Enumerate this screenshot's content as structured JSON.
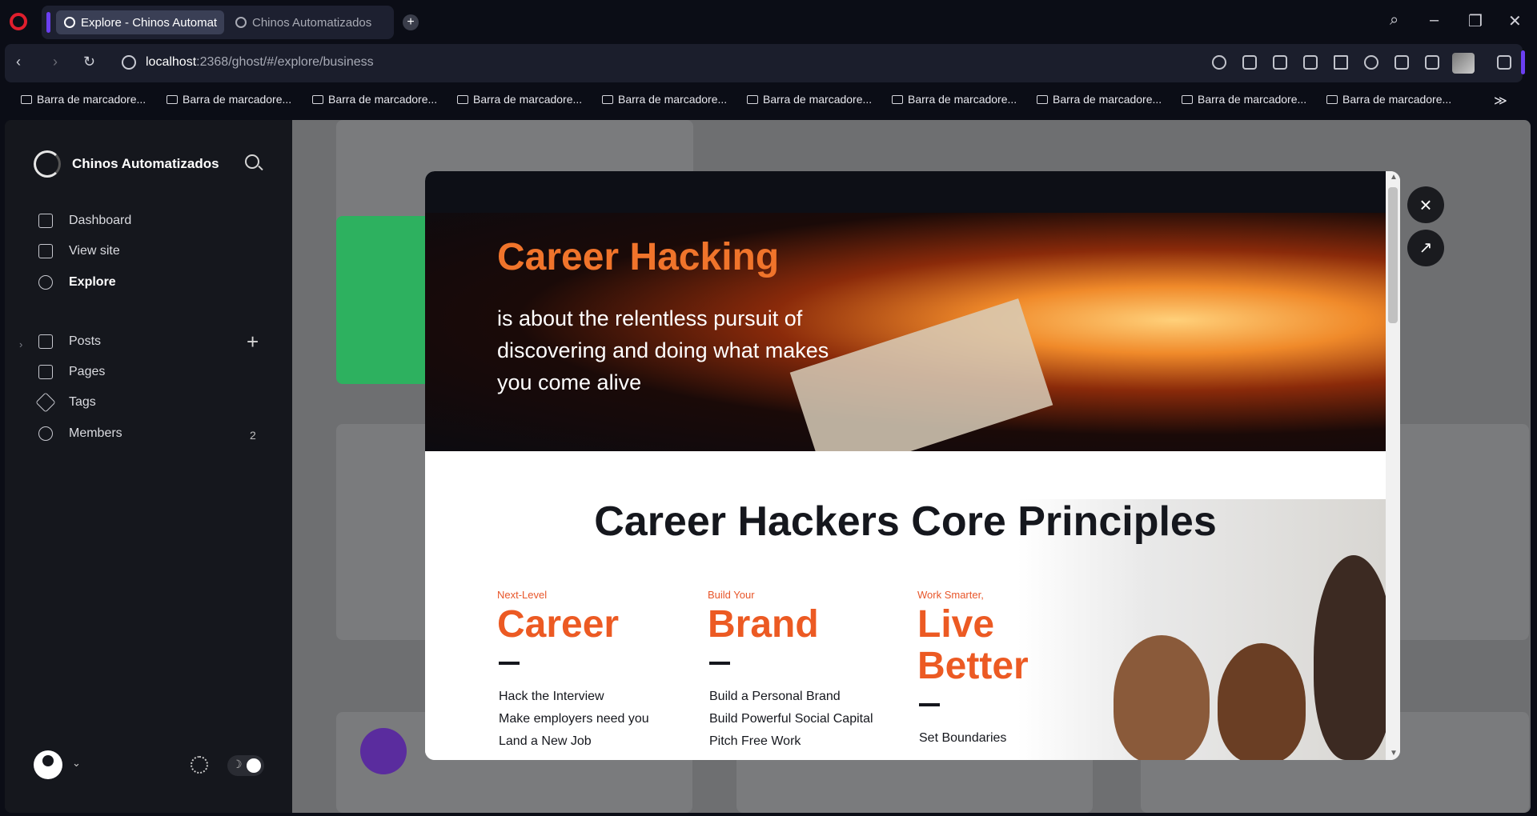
{
  "browser": {
    "tabs": [
      {
        "title": "Explore - Chinos Automat"
      },
      {
        "title": "Chinos Automatizados"
      }
    ],
    "url_host": "localhost",
    "url_rest": ":2368/ghost/#/explore/business",
    "bookmarks": [
      "Barra de marcadore...",
      "Barra de marcadore...",
      "Barra de marcadore...",
      "Barra de marcadore...",
      "Barra de marcadore...",
      "Barra de marcadore...",
      "Barra de marcadore...",
      "Barra de marcadore...",
      "Barra de marcadore...",
      "Barra de marcadore..."
    ],
    "bookmarks_overflow": "≫"
  },
  "sidebar": {
    "site_name": "Chinos Automatizados",
    "items": [
      {
        "label": "Dashboard",
        "icon": "home-icon"
      },
      {
        "label": "View site",
        "icon": "layout-icon"
      },
      {
        "label": "Explore",
        "icon": "globe-icon"
      },
      {
        "label": "Posts",
        "icon": "edit-icon"
      },
      {
        "label": "Pages",
        "icon": "pages-icon"
      },
      {
        "label": "Tags",
        "icon": "tag-icon"
      },
      {
        "label": "Members",
        "icon": "members-icon"
      }
    ],
    "members_count": "2"
  },
  "modal": {
    "hero_title": "Career Hacking",
    "hero_subtitle": "is about the relentless pursuit of discovering and doing what makes you come alive",
    "section_title": "Career Hackers Core Principles",
    "columns": [
      {
        "kicker": "Next-Level",
        "title": "Career",
        "items": [
          "Hack the Interview",
          "Make employers need you",
          "Land a New Job"
        ]
      },
      {
        "kicker": "Build Your",
        "title": "Brand",
        "items": [
          "Build a Personal Brand",
          "Build Powerful Social Capital",
          "Pitch Free Work"
        ]
      },
      {
        "kicker": "Work Smarter,",
        "title_line1": "Live",
        "title_line2": "Better",
        "items": [
          "Set Boundaries"
        ]
      }
    ],
    "close_icon": "×",
    "open_external_icon": "↗"
  },
  "colors": {
    "accent_orange": "#ec5a23",
    "opera_red": "#e01e2d",
    "opera_purple": "#6b3ff2"
  }
}
